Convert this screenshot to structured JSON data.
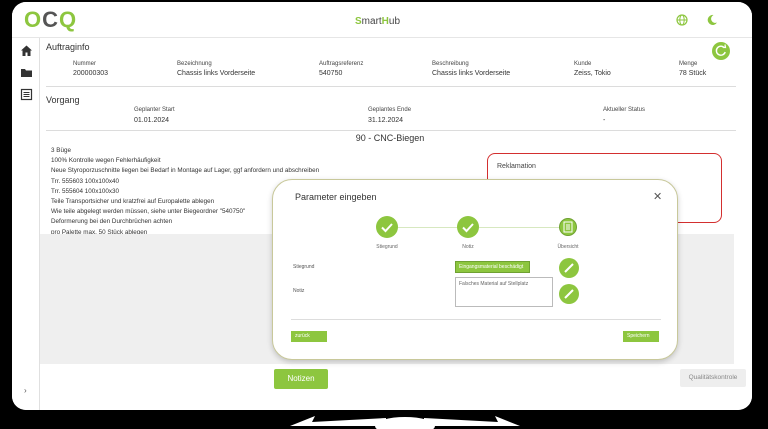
{
  "topbar": {
    "logo_letters": [
      "O",
      "C",
      "Q"
    ],
    "brand_prefix": "S",
    "brand_middle": "mart",
    "brand_suffix_accent": "H",
    "brand_suffix": "ub",
    "accent_color": "#8dc63f"
  },
  "order_info": {
    "title": "Auftraginfo",
    "fields": [
      {
        "label": "Nummer",
        "value": "200000303"
      },
      {
        "label": "Bezeichnung",
        "value": "Chassis links Vorderseite"
      },
      {
        "label": "Auftragsreferenz",
        "value": "540750"
      },
      {
        "label": "Beschreibung",
        "value": "Chassis links Vorderseite"
      },
      {
        "label": "Kunde",
        "value": "Zeiss, Tokio"
      },
      {
        "label": "Menge",
        "value": "78 Stück"
      }
    ]
  },
  "process": {
    "title": "Vorgang",
    "fields": [
      {
        "label": "Geplanter Start",
        "value": "01.01.2024"
      },
      {
        "label": "Geplantes Ende",
        "value": "31.12.2024"
      },
      {
        "label": "Aktueller Status",
        "value": "-"
      }
    ],
    "operation_title": "90 - CNC-Biegen",
    "instructions": [
      "3 Büge",
      "100% Kontrolle wegen Fehlerhäufigkeit",
      "Neue Styroporzuschnitte liegen bei Bedarf in Montage auf Lager, ggf anfordern und abschreiben",
      "Trr. 555603 100x100x40",
      "Trr. 555604 100x100x30",
      "Teile Transportsicher und kratzfrei auf Europalette ablegen",
      "Wie teile abgelegt werden müssen, siehe unter Biegeordner \"540750\"",
      "Deformerung bei den Durchbrüchen achten",
      "pro Palette max. 50 Stück ablegen"
    ],
    "complaint_label": "Reklamation"
  },
  "buttons": {
    "notes": "Notizen",
    "quality": "Qualitätskontrole"
  },
  "modal": {
    "title": "Parameter eingeben",
    "steps": [
      "Stiegrund",
      "Notiz",
      "Übersicht"
    ],
    "field_reason_label": "Stiegrund",
    "field_reason_value": "Eingangsmaterial beschädigt",
    "field_note_label": "Notiz",
    "field_note_value": "Falsches Material auf Stellplatz",
    "back_label": "zurück",
    "save_label": "Speichern"
  }
}
